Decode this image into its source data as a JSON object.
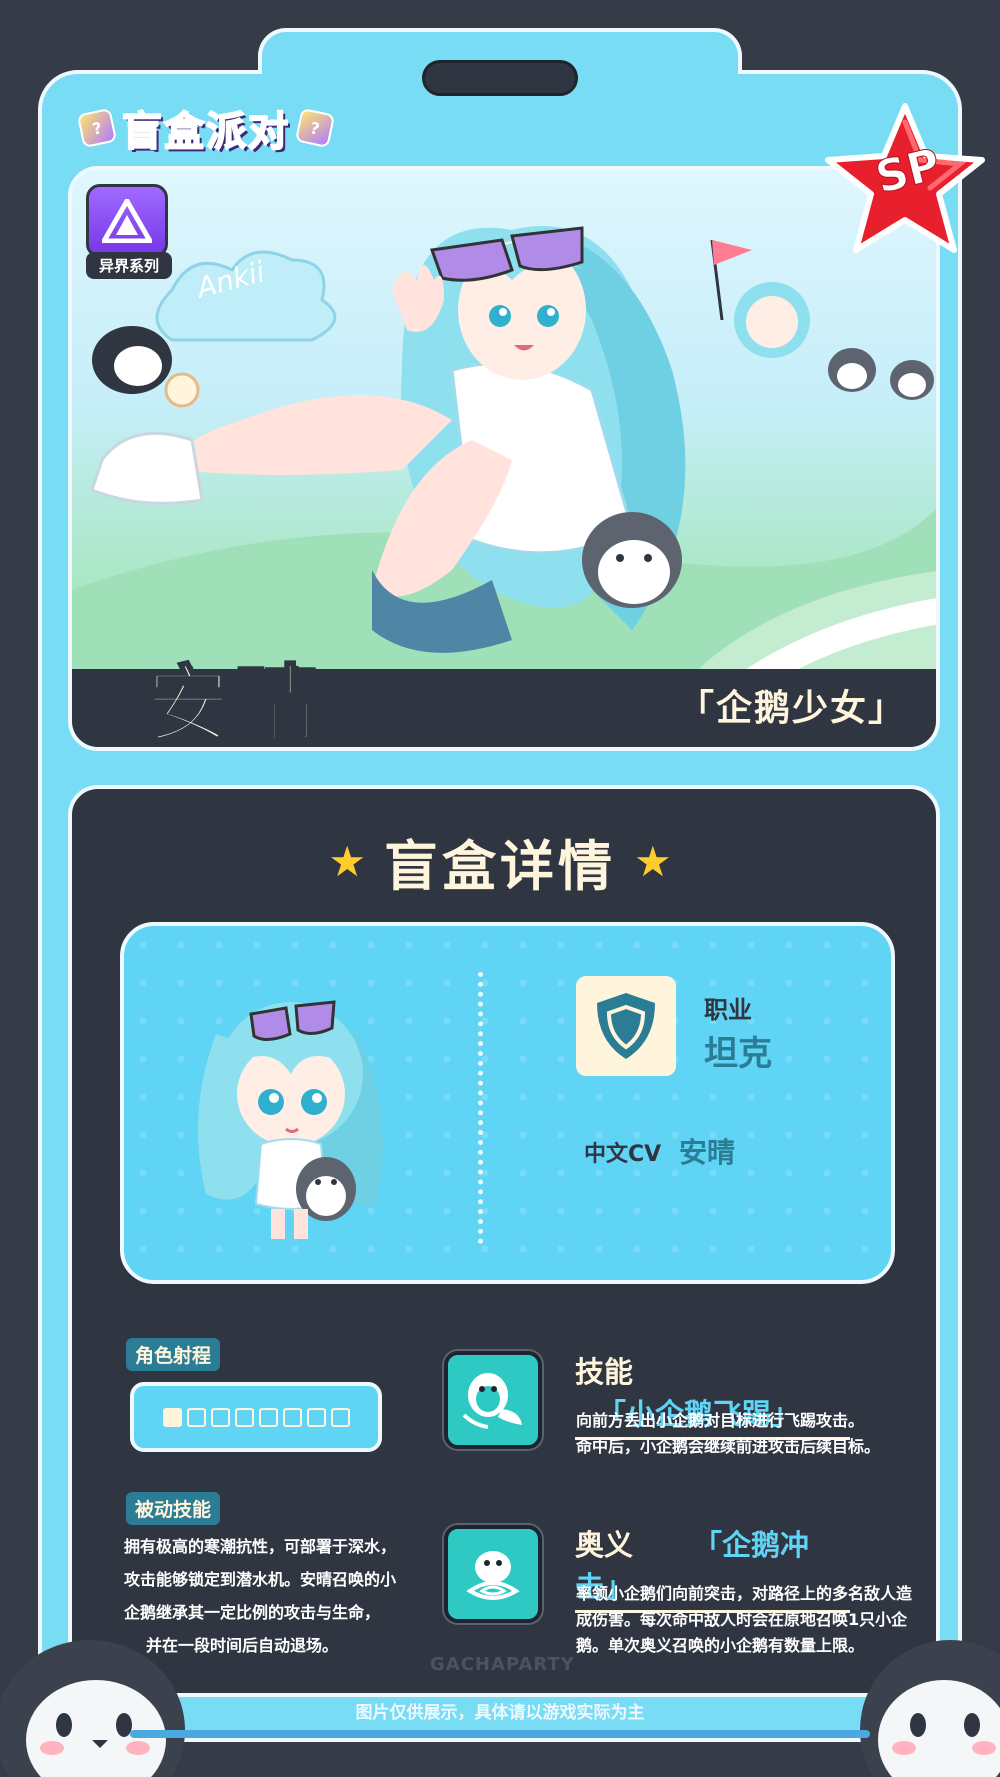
{
  "brand": {
    "logo_text": "盲盒派对",
    "cube_glyph": "?"
  },
  "badge": {
    "rarity": "SP",
    "color": "#e8202e"
  },
  "series": {
    "label": "异界系列",
    "color": "#8a4cff"
  },
  "character": {
    "name": "安晴",
    "title": "「企鹅少女」",
    "art_text": "Ankii"
  },
  "details": {
    "heading": "盲盒详情",
    "class_label": "职业",
    "class_value": "坦克",
    "class_icon": "shield-icon",
    "cv_label": "中文CV",
    "cv_value": "安晴"
  },
  "range": {
    "label": "角色射程",
    "value": 1,
    "max": 8
  },
  "passive": {
    "label": "被动技能",
    "lines": [
      "拥有极高的寒潮抗性，可部署于深水，",
      "攻击能够锁定到潜水机。安晴召唤的小",
      "企鹅继承其一定比例的攻击与生命，",
      "并在一段时间后自动退场。"
    ]
  },
  "skill": {
    "kind": "技能",
    "name": "「小企鹅飞踢」",
    "lines": [
      "向前方丢出小企鹅对目标进行飞踢攻击。",
      "命中后，小企鹅会继续前进攻击后续目标。"
    ]
  },
  "ultimate": {
    "kind": "奥义",
    "name": "「企鹅冲击」",
    "lines": [
      "率领小企鹅们向前突击，对路径上的多名敌人造",
      "成伤害。每次命中敌人时会在原地召唤1只小企",
      "鹅。单次奥义召唤的小企鹅有数量上限。"
    ]
  },
  "watermark": "GACHAPARTY",
  "footer": {
    "note": "图片仅供展示，具体请以游戏实际为主"
  },
  "colors": {
    "frame": "#79dcf5",
    "panel": "#2f3541",
    "accent_cream": "#fff5dc",
    "accent_teal": "#2b7c95",
    "sky": "#5fd4f4"
  }
}
